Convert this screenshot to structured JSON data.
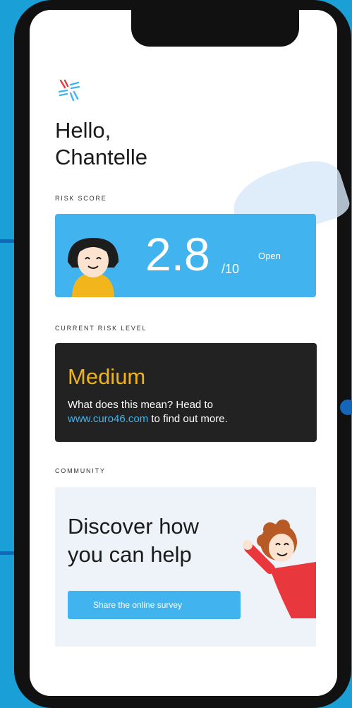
{
  "greeting": {
    "line1": "Hello,",
    "line2": "Chantelle"
  },
  "risk": {
    "section_label": "RISK SCORE",
    "score": "2.8",
    "max": "/10",
    "open_label": "Open"
  },
  "level": {
    "section_label": "CURRENT RISK LEVEL",
    "value": "Medium",
    "desc_part1": "What does this mean? Head to",
    "link": "www.curo46.com",
    "desc_part2": " to find out more."
  },
  "community": {
    "section_label": "COMMUNITY",
    "title_line1": "Discover how",
    "title_line2": "you can help",
    "button_label": "Share the online survey"
  },
  "colors": {
    "accent": "#41b4ef",
    "medium": "#f0b418",
    "background": "#1a9fd6"
  },
  "icons": [
    "app-logo-icon",
    "girl-avatar-icon",
    "waving-person-illustration"
  ]
}
